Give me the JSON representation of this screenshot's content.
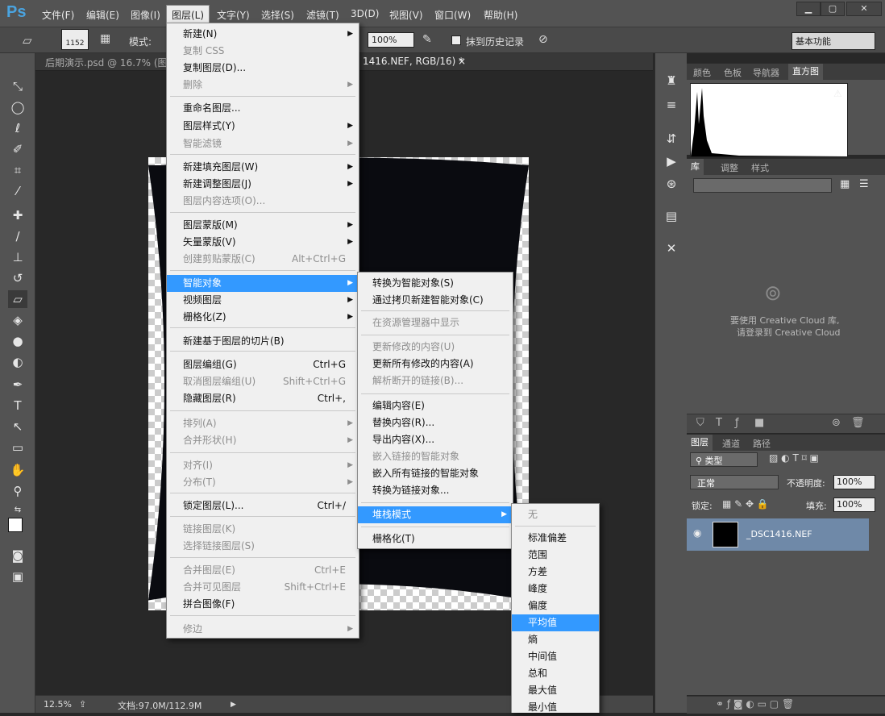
{
  "app": {
    "logo": "Ps"
  },
  "menubar": {
    "items": [
      "文件(F)",
      "编辑(E)",
      "图像(I)",
      "图层(L)",
      "文字(Y)",
      "选择(S)",
      "滤镜(T)",
      "3D(D)",
      "视图(V)",
      "窗口(W)",
      "帮助(H)"
    ]
  },
  "window_controls": {
    "minimize": "▁",
    "restore": "▢",
    "close": "✕"
  },
  "options_bar": {
    "brush_size": "1152",
    "mode_label": "模式:",
    "flow_value": "100%",
    "erase_history": "抹到历史记录",
    "workspace": "基本功能"
  },
  "tabs": [
    {
      "label": "后期演示.psd @ 16.7% (图层"
    },
    {
      "label": "1416.NEF, RGB/16) *"
    }
  ],
  "tab_close": "×",
  "status_bar": {
    "zoom": "12.5%",
    "doc_size": "文档:97.0M/112.9M"
  },
  "panels": {
    "histogram_tabs": [
      "颜色",
      "色板",
      "导航器",
      "直方图"
    ],
    "library_tabs": [
      "库",
      "调整",
      "样式"
    ],
    "cloud_message_1": "要使用 Creative Cloud 库,",
    "cloud_message_2": "请登录到 Creative Cloud",
    "layers_tabs": [
      "图层",
      "通道",
      "路径"
    ],
    "filter_kind": "类型",
    "blend_mode": "正常",
    "opacity_label": "不透明度:",
    "opacity_value": "100%",
    "lock_label": "锁定:",
    "fill_label": "填充:",
    "fill_value": "100%",
    "layer_name": "_DSC1416.NEF"
  },
  "layer_menu": {
    "items": [
      {
        "label": "新建(N)",
        "shortcut": "",
        "submenu": true,
        "disabled": false
      },
      {
        "label": "复制 CSS",
        "shortcut": "",
        "submenu": false,
        "disabled": true
      },
      {
        "label": "复制图层(D)...",
        "shortcut": "",
        "submenu": false,
        "disabled": false
      },
      {
        "label": "删除",
        "shortcut": "",
        "submenu": true,
        "disabled": true
      },
      {
        "label": "重命名图层...",
        "shortcut": "",
        "submenu": false,
        "disabled": false
      },
      {
        "label": "图层样式(Y)",
        "shortcut": "",
        "submenu": true,
        "disabled": false
      },
      {
        "label": "智能滤镜",
        "shortcut": "",
        "submenu": true,
        "disabled": true
      },
      {
        "label": "新建填充图层(W)",
        "shortcut": "",
        "submenu": true,
        "disabled": false
      },
      {
        "label": "新建调整图层(J)",
        "shortcut": "",
        "submenu": true,
        "disabled": false
      },
      {
        "label": "图层内容选项(O)...",
        "shortcut": "",
        "submenu": false,
        "disabled": true
      },
      {
        "label": "图层蒙版(M)",
        "shortcut": "",
        "submenu": true,
        "disabled": false
      },
      {
        "label": "矢量蒙版(V)",
        "shortcut": "",
        "submenu": true,
        "disabled": false
      },
      {
        "label": "创建剪贴蒙版(C)",
        "shortcut": "Alt+Ctrl+G",
        "submenu": false,
        "disabled": true
      },
      {
        "label": "智能对象",
        "shortcut": "",
        "submenu": true,
        "disabled": false,
        "highlight": true
      },
      {
        "label": "视频图层",
        "shortcut": "",
        "submenu": true,
        "disabled": false
      },
      {
        "label": "栅格化(Z)",
        "shortcut": "",
        "submenu": true,
        "disabled": false
      },
      {
        "label": "新建基于图层的切片(B)",
        "shortcut": "",
        "submenu": false,
        "disabled": false
      },
      {
        "label": "图层编组(G)",
        "shortcut": "Ctrl+G",
        "submenu": false,
        "disabled": false
      },
      {
        "label": "取消图层编组(U)",
        "shortcut": "Shift+Ctrl+G",
        "submenu": false,
        "disabled": true
      },
      {
        "label": "隐藏图层(R)",
        "shortcut": "Ctrl+,",
        "submenu": false,
        "disabled": false
      },
      {
        "label": "排列(A)",
        "shortcut": "",
        "submenu": true,
        "disabled": true
      },
      {
        "label": "合并形状(H)",
        "shortcut": "",
        "submenu": true,
        "disabled": true
      },
      {
        "label": "对齐(I)",
        "shortcut": "",
        "submenu": true,
        "disabled": true
      },
      {
        "label": "分布(T)",
        "shortcut": "",
        "submenu": true,
        "disabled": true
      },
      {
        "label": "锁定图层(L)...",
        "shortcut": "Ctrl+/",
        "submenu": false,
        "disabled": false
      },
      {
        "label": "链接图层(K)",
        "shortcut": "",
        "submenu": false,
        "disabled": true
      },
      {
        "label": "选择链接图层(S)",
        "shortcut": "",
        "submenu": false,
        "disabled": true
      },
      {
        "label": "合并图层(E)",
        "shortcut": "Ctrl+E",
        "submenu": false,
        "disabled": true
      },
      {
        "label": "合并可见图层",
        "shortcut": "Shift+Ctrl+E",
        "submenu": false,
        "disabled": true
      },
      {
        "label": "拼合图像(F)",
        "shortcut": "",
        "submenu": false,
        "disabled": false
      },
      {
        "label": "修边",
        "shortcut": "",
        "submenu": true,
        "disabled": true
      }
    ]
  },
  "smart_object_menu": {
    "items": [
      {
        "label": "转换为智能对象(S)",
        "disabled": false,
        "submenu": false
      },
      {
        "label": "通过拷贝新建智能对象(C)",
        "disabled": false,
        "submenu": false
      },
      {
        "label": "在资源管理器中显示",
        "disabled": true,
        "submenu": false
      },
      {
        "label": "更新修改的内容(U)",
        "disabled": true,
        "submenu": false
      },
      {
        "label": "更新所有修改的内容(A)",
        "disabled": false,
        "submenu": false
      },
      {
        "label": "解析断开的链接(B)...",
        "disabled": true,
        "submenu": false
      },
      {
        "label": "编辑内容(E)",
        "disabled": false,
        "submenu": false
      },
      {
        "label": "替换内容(R)...",
        "disabled": false,
        "submenu": false
      },
      {
        "label": "导出内容(X)...",
        "disabled": false,
        "submenu": false
      },
      {
        "label": "嵌入链接的智能对象",
        "disabled": true,
        "submenu": false
      },
      {
        "label": "嵌入所有链接的智能对象",
        "disabled": false,
        "submenu": false
      },
      {
        "label": "转换为链接对象...",
        "disabled": false,
        "submenu": false
      },
      {
        "label": "堆栈模式",
        "disabled": false,
        "submenu": true,
        "highlight": true
      },
      {
        "label": "栅格化(T)",
        "disabled": false,
        "submenu": false
      }
    ]
  },
  "stack_mode_menu": {
    "items": [
      {
        "label": "无",
        "disabled": true
      },
      {
        "label": "标准偏差",
        "disabled": false
      },
      {
        "label": "范围",
        "disabled": false
      },
      {
        "label": "方差",
        "disabled": false
      },
      {
        "label": "峰度",
        "disabled": false
      },
      {
        "label": "偏度",
        "disabled": false
      },
      {
        "label": "平均值",
        "disabled": false,
        "highlight": true
      },
      {
        "label": "熵",
        "disabled": false
      },
      {
        "label": "中间值",
        "disabled": false
      },
      {
        "label": "总和",
        "disabled": false
      },
      {
        "label": "最大值",
        "disabled": false
      },
      {
        "label": "最小值",
        "disabled": false
      }
    ]
  }
}
